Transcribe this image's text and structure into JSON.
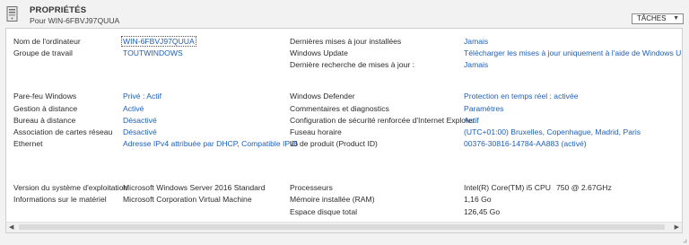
{
  "header": {
    "icon": "server-icon",
    "title": "PROPRIÉTÉS",
    "subtitle": "Pour WIN-6FBVJ97QUUA",
    "tasks_label": "TÂCHES",
    "tasks_caret": "▼"
  },
  "col1": [
    {
      "label": "Nom de l'ordinateur",
      "value": "WIN-6FBVJ97QUUA"
    },
    {
      "label": "Groupe de travail",
      "value": "TOUTWINDOWS"
    },
    {
      "label": "Pare-feu Windows",
      "value": "Privé : Actif"
    },
    {
      "label": "Gestion à distance",
      "value": "Activé"
    },
    {
      "label": "Bureau à distance",
      "value": "Désactivé"
    },
    {
      "label": "Association de cartes réseau",
      "value": "Désactivé"
    },
    {
      "label": "Ethernet",
      "value": "Adresse IPv4 attribuée par DHCP, Compatible IPv6"
    }
  ],
  "col2": [
    {
      "label": "Dernières mises à jour installées",
      "value": "Jamais"
    },
    {
      "label": "Windows Update",
      "value": "Télécharger les mises à jour uniquement à l'aide de Windows Update"
    },
    {
      "label": "Dernière recherche de mises à jour :",
      "value": "Jamais"
    },
    {
      "label": "Windows Defender",
      "value": "Protection en temps réel : activée"
    },
    {
      "label": "Commentaires et diagnostics",
      "value": "Paramètres"
    },
    {
      "label": "Configuration de sécurité renforcée d'Internet Explorer",
      "value": "Actif"
    },
    {
      "label": "Fuseau horaire",
      "value": "(UTC+01:00) Bruxelles, Copenhague, Madrid, Paris"
    },
    {
      "label": "ID de produit (Product ID)",
      "value": "00376-30816-14784-AA883 (activé)"
    }
  ],
  "hardware": {
    "os_label": "Version du système d'exploitation",
    "os_value": "Microsoft Windows Server 2016 Standard",
    "hw_label": "Informations sur le matériel",
    "hw_value": "Microsoft Corporation Virtual Machine",
    "cpu_label": "Processeurs",
    "cpu_value_a": "Intel(R) Core(TM) i5 CPU",
    "cpu_value_b": "750  @ 2.67GHz",
    "ram_label": "Mémoire installée (RAM)",
    "ram_value": "1,16 Go",
    "disk_label": "Espace disque total",
    "disk_value": "126,45 Go"
  },
  "scrollbar": {
    "left_arrow": "◀",
    "right_arrow": "▶"
  }
}
